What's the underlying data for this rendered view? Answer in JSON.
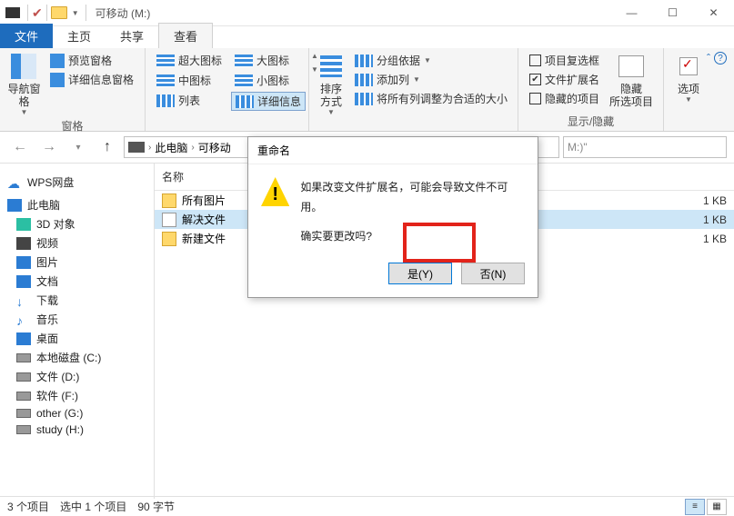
{
  "window": {
    "title": "可移动 (M:)"
  },
  "tabs": {
    "file": "文件",
    "home": "主页",
    "share": "共享",
    "view": "查看"
  },
  "ribbon": {
    "group1": {
      "nav": "导航窗格",
      "preview": "预览窗格",
      "details": "详细信息窗格",
      "label": "窗格"
    },
    "group2": {
      "xlarge": "超大图标",
      "large": "大图标",
      "medium": "中图标",
      "small": "小图标",
      "list": "列表",
      "details": "详细信息"
    },
    "group3": {
      "sort": "排序方式",
      "groupby": "分组依据",
      "addcol": "添加列",
      "autosize": "将所有列调整为合适的大小"
    },
    "group4": {
      "chk_box": "项目复选框",
      "chk_ext": "文件扩展名",
      "chk_hidden": "隐藏的项目",
      "hide": "隐藏\n所选项目",
      "label": "显示/隐藏"
    },
    "group5": {
      "options": "选项"
    }
  },
  "address": {
    "pc": "此电脑",
    "drive": "可移动",
    "search_placeholder": "M:)\""
  },
  "sidebar": {
    "wps": "WPS网盘",
    "pc": "此电脑",
    "items": [
      "3D 对象",
      "视频",
      "图片",
      "文档",
      "下载",
      "音乐",
      "桌面",
      "本地磁盘 (C:)",
      "文件 (D:)",
      "软件 (F:)",
      "other (G:)",
      "study (H:)"
    ]
  },
  "filelist": {
    "hdr_name": "名称",
    "rows": [
      {
        "name": "所有图片",
        "size": "1 KB",
        "type": "folder"
      },
      {
        "name": "解决文件",
        "size": "1 KB",
        "type": "txt",
        "selected": true
      },
      {
        "name": "新建文件",
        "size": "1 KB",
        "type": "folder"
      }
    ]
  },
  "dialog": {
    "title": "重命名",
    "line1": "如果改变文件扩展名，可能会导致文件不可用。",
    "line2": "确实要更改吗?",
    "yes": "是(Y)",
    "no": "否(N)"
  },
  "status": {
    "count": "3 个项目",
    "sel": "选中 1 个项目",
    "bytes": "90 字节"
  }
}
